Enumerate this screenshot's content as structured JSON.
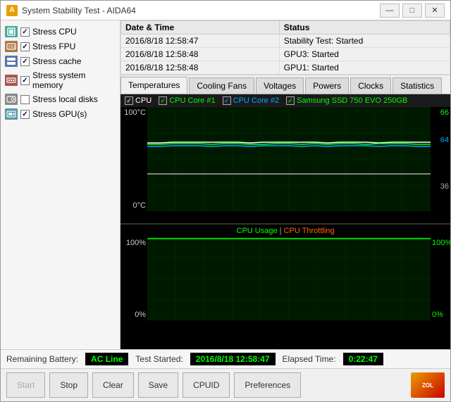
{
  "window": {
    "title": "System Stability Test - AIDA64",
    "icon": "A"
  },
  "title_buttons": {
    "minimize": "—",
    "maximize": "□",
    "close": "✕"
  },
  "checkboxes": [
    {
      "id": "stress-cpu",
      "label": "Stress CPU",
      "checked": true,
      "icon_color": "#4a9"
    },
    {
      "id": "stress-fpu",
      "label": "Stress FPU",
      "checked": true,
      "icon_color": "#a74"
    },
    {
      "id": "stress-cache",
      "label": "Stress cache",
      "checked": true,
      "icon_color": "#57a"
    },
    {
      "id": "stress-memory",
      "label": "Stress system memory",
      "checked": true,
      "icon_color": "#a55"
    },
    {
      "id": "stress-disks",
      "label": "Stress local disks",
      "checked": false,
      "icon_color": "#888"
    },
    {
      "id": "stress-gpu",
      "label": "Stress GPU(s)",
      "checked": true,
      "icon_color": "#59a"
    }
  ],
  "log": {
    "headers": [
      "Date & Time",
      "Status"
    ],
    "rows": [
      {
        "datetime": "2016/8/18 12:58:47",
        "status": "Stability Test: Started"
      },
      {
        "datetime": "2016/8/18 12:58:48",
        "status": "GPU3: Started"
      },
      {
        "datetime": "2016/8/18 12:58:48",
        "status": "GPU1: Started"
      }
    ]
  },
  "tabs": [
    {
      "id": "temperatures",
      "label": "Temperatures",
      "active": true
    },
    {
      "id": "cooling-fans",
      "label": "Cooling Fans",
      "active": false
    },
    {
      "id": "voltages",
      "label": "Voltages",
      "active": false
    },
    {
      "id": "powers",
      "label": "Powers",
      "active": false
    },
    {
      "id": "clocks",
      "label": "Clocks",
      "active": false
    },
    {
      "id": "statistics",
      "label": "Statistics",
      "active": false
    }
  ],
  "temp_chart": {
    "legend": [
      {
        "label": "CPU",
        "color": "#ffffff"
      },
      {
        "label": "CPU Core #1",
        "color": "#00ff00"
      },
      {
        "label": "CPU Core #2",
        "color": "#00aaff"
      },
      {
        "label": "Samsung SSD 750 EVO 250GB",
        "color": "#00ff00"
      }
    ],
    "y_labels_left": [
      "100°C",
      "",
      "",
      "",
      "",
      "0°C"
    ],
    "y_labels_right": [
      "66",
      "64",
      "",
      "36",
      "",
      ""
    ]
  },
  "cpu_chart": {
    "title1": "CPU Usage",
    "pipe": "|",
    "title2": "CPU Throttling",
    "y_labels_left": [
      "100%",
      "",
      "",
      "",
      "",
      "0%"
    ],
    "y_labels_right": [
      "100%",
      "",
      "",
      "",
      "",
      "0%"
    ]
  },
  "status_bar": {
    "battery_label": "Remaining Battery:",
    "battery_value": "AC Line",
    "test_started_label": "Test Started:",
    "test_started_value": "2016/8/18 12:58:47",
    "elapsed_label": "Elapsed Time:",
    "elapsed_value": "0:22:47"
  },
  "buttons": [
    {
      "id": "start",
      "label": "Start",
      "disabled": true
    },
    {
      "id": "stop",
      "label": "Stop",
      "disabled": false
    },
    {
      "id": "clear",
      "label": "Clear",
      "disabled": false
    },
    {
      "id": "save",
      "label": "Save",
      "disabled": false
    },
    {
      "id": "cpuid",
      "label": "CPUID",
      "disabled": false
    },
    {
      "id": "preferences",
      "label": "Preferences",
      "disabled": false
    }
  ]
}
